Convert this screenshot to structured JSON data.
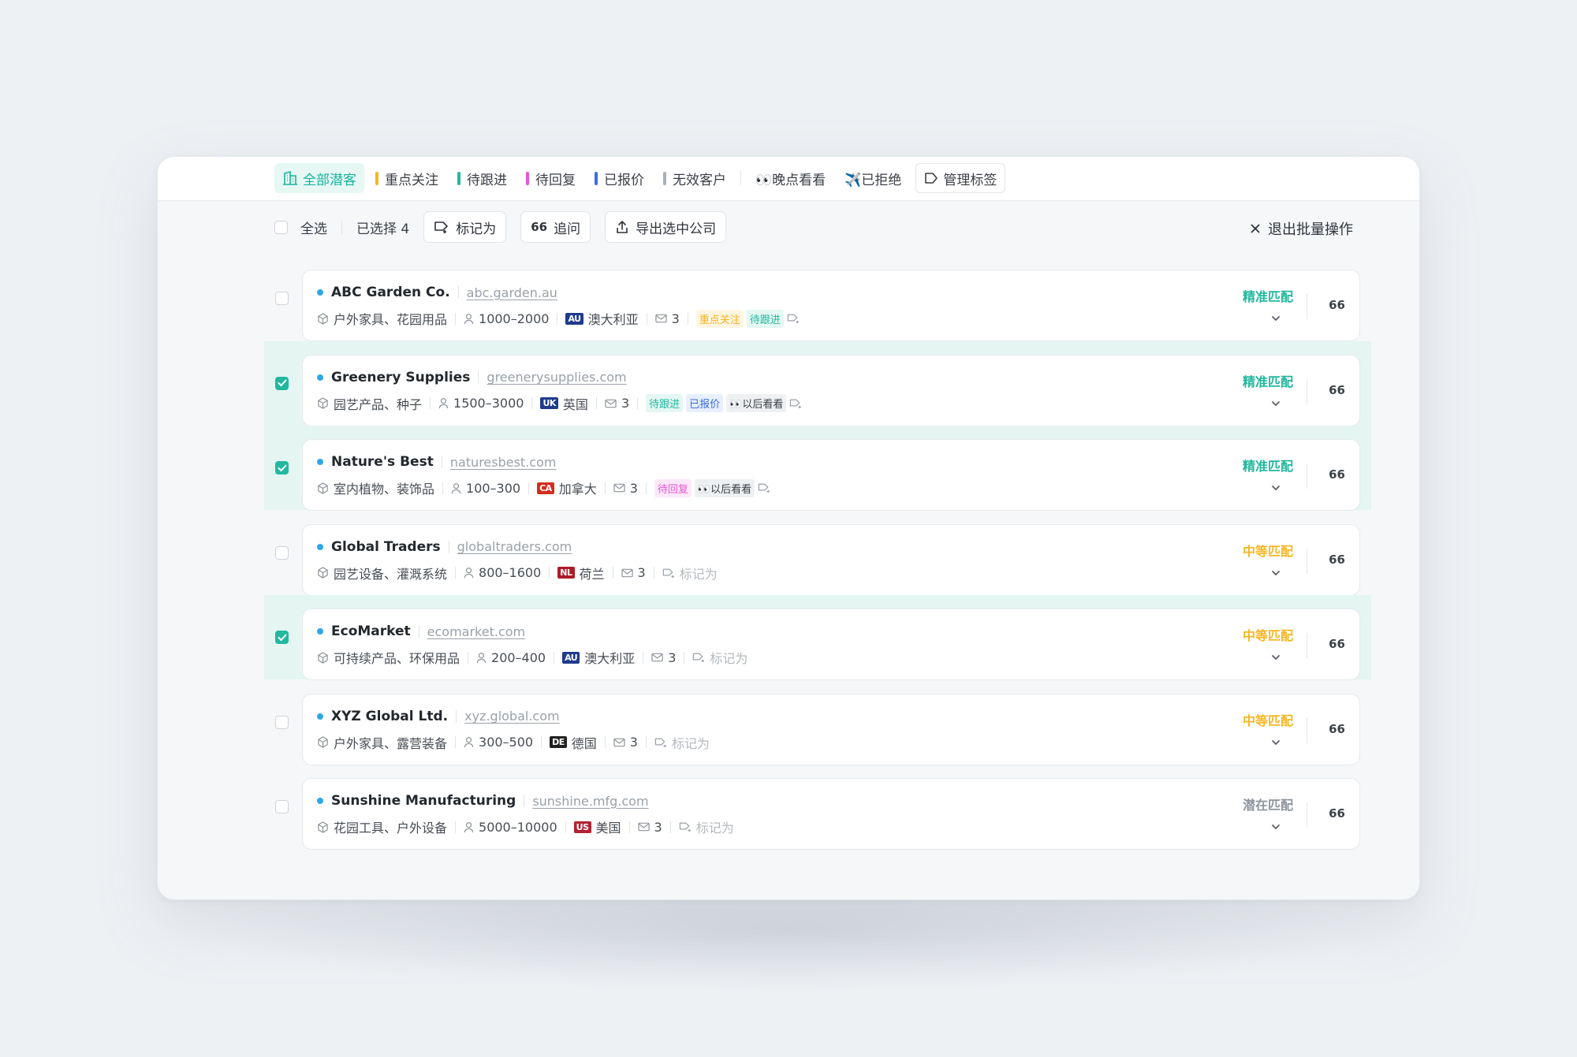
{
  "tabs": [
    {
      "label": "全部潜客",
      "color": "#17b59c",
      "active": true
    },
    {
      "label": "重点关注",
      "color": "#f5b723"
    },
    {
      "label": "待跟进",
      "color": "#22b89f"
    },
    {
      "label": "待回复",
      "color": "#e455d2"
    },
    {
      "label": "已报价",
      "color": "#3b6ee0"
    },
    {
      "label": "无效客户",
      "color": "#a9b0b8"
    },
    {
      "label": "👀晚点看看"
    },
    {
      "label": "✈️已拒绝"
    },
    {
      "label": "管理标签"
    }
  ],
  "toolbar": {
    "select_all": "全选",
    "selected": "已选择 4",
    "mark_as": "标记为",
    "follow_up": "追问",
    "export": "导出选中公司",
    "exit": "退出批量操作"
  },
  "quote_glyph": "66",
  "companies": [
    {
      "name": "ABC Garden Co.",
      "domain": "abc.garden.au",
      "industry": "户外家具、花园用品",
      "size": "1000–2000",
      "flag": "AU",
      "flag_color": "#1f3b8c",
      "country": "澳大利亚",
      "mails": "3",
      "tags": [
        {
          "text": "重点关注",
          "style": "yellow"
        },
        {
          "text": "待跟进",
          "style": "teal"
        }
      ],
      "mark_label": "",
      "match": "精准匹配",
      "match_color": "#20b79c",
      "selected": false
    },
    {
      "name": "Greenery Supplies",
      "domain": "greenerysupplies.com",
      "industry": "园艺产品、种子",
      "size": "1500–3000",
      "flag": "UK",
      "flag_color": "#1f3b8c",
      "country": "英国",
      "mails": "3",
      "tags": [
        {
          "text": "待跟进",
          "style": "teal"
        },
        {
          "text": "已报价",
          "style": "blue"
        },
        {
          "text": "👀以后看看",
          "style": "gray"
        }
      ],
      "mark_label": "",
      "match": "精准匹配",
      "match_color": "#20b79c",
      "selected": true
    },
    {
      "name": "Nature's Best",
      "domain": "naturesbest.com",
      "industry": "室内植物、装饰品",
      "size": "100–300",
      "flag": "CA",
      "flag_color": "#d52b1e",
      "country": "加拿大",
      "mails": "3",
      "tags": [
        {
          "text": "待回复",
          "style": "pink"
        },
        {
          "text": "👀以后看看",
          "style": "gray"
        }
      ],
      "mark_label": "",
      "match": "精准匹配",
      "match_color": "#20b79c",
      "selected": true
    },
    {
      "name": "Global Traders",
      "domain": "globaltraders.com",
      "industry": "园艺设备、灌溉系统",
      "size": "800–1600",
      "flag": "NL",
      "flag_color": "#ae1c28",
      "country": "荷兰",
      "mails": "3",
      "tags": [],
      "mark_label": "标记为",
      "match": "中等匹配",
      "match_color": "#f5b723",
      "selected": false
    },
    {
      "name": "EcoMarket",
      "domain": "ecomarket.com",
      "industry": "可持续产品、环保用品",
      "size": "200–400",
      "flag": "AU",
      "flag_color": "#1f3b8c",
      "country": "澳大利亚",
      "mails": "3",
      "tags": [],
      "mark_label": "标记为",
      "match": "中等匹配",
      "match_color": "#f5b723",
      "selected": true
    },
    {
      "name": "XYZ Global Ltd.",
      "domain": "xyz.global.com",
      "industry": "户外家具、露营装备",
      "size": "300–500",
      "flag": "DE",
      "flag_color": "#222222",
      "country": "德国",
      "mails": "3",
      "tags": [],
      "mark_label": "标记为",
      "match": "中等匹配",
      "match_color": "#f5b723",
      "selected": false
    },
    {
      "name": "Sunshine Manufacturing",
      "domain": "sunshine.mfg.com",
      "industry": "花园工具、户外设备",
      "size": "5000–10000",
      "flag": "US",
      "flag_color": "#b22234",
      "country": "美国",
      "mails": "3",
      "tags": [],
      "mark_label": "标记为",
      "match": "潜在匹配",
      "match_color": "#8d949c",
      "selected": false
    }
  ]
}
